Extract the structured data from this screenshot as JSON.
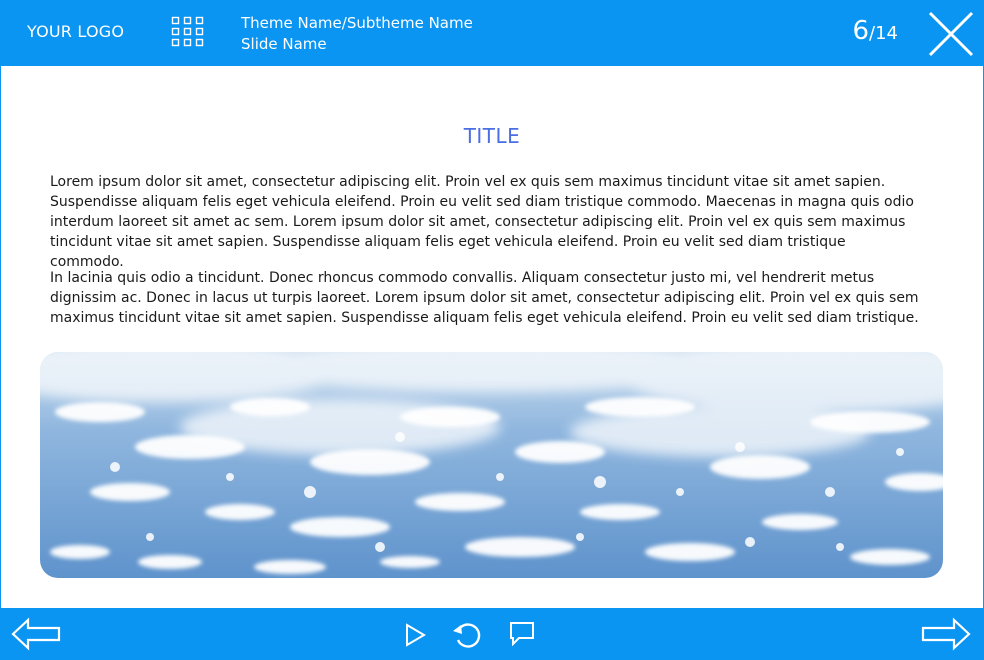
{
  "header": {
    "logo_text": "YOUR LOGO",
    "theme_name": "Theme Name/Subtheme Name",
    "slide_name": "Slide Name",
    "current_slide": "6",
    "separator": "/",
    "total_slides": "14",
    "menu_icon": "grid-menu-icon",
    "close_icon": "close-icon"
  },
  "slide": {
    "title": "TITLE",
    "paragraph_1": "Lorem ipsum dolor sit amet, consectetur adipiscing elit. Proin vel ex quis sem maximus tincidunt vitae sit amet sapien. Suspendisse aliquam felis eget vehicula eleifend. Proin eu velit sed diam tristique commodo. Maecenas in magna quis odio interdum laoreet sit amet ac sem. Lorem ipsum dolor sit amet, consectetur adipiscing elit. Proin vel ex quis sem maximus tincidunt vitae sit amet sapien. Suspendisse aliquam felis eget vehicula eleifend. Proin eu velit sed diam tristique commodo.",
    "paragraph_2": "In lacinia quis odio a tincidunt. Donec rhoncus commodo convallis. Aliquam consectetur justo mi, vel hendrerit metus dignissim ac. Donec in lacus ut turpis laoreet. Lorem ipsum dolor sit amet, consectetur adipiscing elit. Proin vel ex quis sem maximus tincidunt vitae sit amet sapien. Suspendisse aliquam felis eget vehicula eleifend. Proin eu velit sed diam tristique.",
    "image": "aerial-clouds-image"
  },
  "footer": {
    "prev_icon": "arrow-left-icon",
    "play_icon": "play-icon",
    "replay_icon": "replay-icon",
    "comment_icon": "comment-icon",
    "next_icon": "arrow-right-icon"
  },
  "colors": {
    "bar": "#0a95f2",
    "title": "#4a6fe3",
    "text": "#1a1a1a"
  }
}
